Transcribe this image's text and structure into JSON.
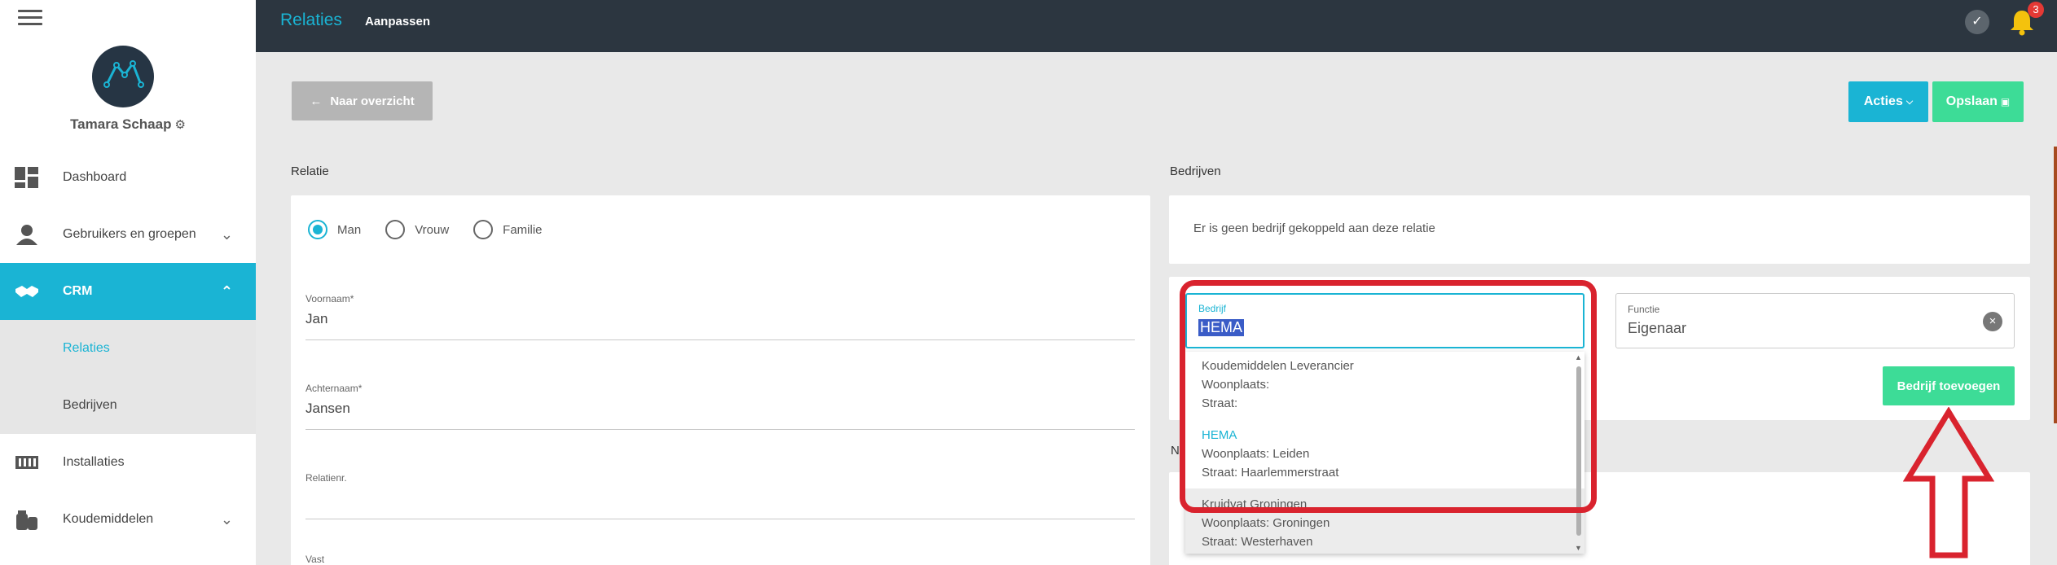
{
  "sidebar": {
    "user_name": "Tamara Schaap",
    "items": [
      {
        "label": "Dashboard"
      },
      {
        "label": "Gebruikers en groepen"
      },
      {
        "label": "CRM"
      },
      {
        "label": "Relaties"
      },
      {
        "label": "Bedrijven"
      },
      {
        "label": "Installaties"
      },
      {
        "label": "Koudemiddelen"
      }
    ]
  },
  "topbar": {
    "title": "Relaties",
    "subtitle": "Aanpassen",
    "notification_count": "3"
  },
  "toolbar": {
    "back_label": "Naar overzicht",
    "acties_label": "Acties",
    "opslaan_label": "Opslaan"
  },
  "relatie": {
    "section_title": "Relatie",
    "gender_options": [
      "Man",
      "Vrouw",
      "Familie"
    ],
    "selected_gender": "Man",
    "voornaam_label": "Voornaam*",
    "voornaam_value": "Jan",
    "achternaam_label": "Achternaam*",
    "achternaam_value": "Jansen",
    "relatienr_label": "Relatienr.",
    "relatienr_value": "",
    "vast_label": "Vast"
  },
  "bedrijven": {
    "section_title": "Bedrijven",
    "empty_message": "Er is geen bedrijf gekoppeld aan deze relatie",
    "bedrijf_label": "Bedrijf",
    "bedrijf_value": "HEMA",
    "functie_label": "Functie",
    "functie_value": "Eigenaar",
    "add_button_label": "Bedrijf toevoegen",
    "partial_heading": "N"
  },
  "dropdown": {
    "options": [
      {
        "name": "Koudemiddelen Leverancier",
        "woonplaats": "Woonplaats:",
        "straat": "Straat:"
      },
      {
        "name": "HEMA",
        "woonplaats": "Woonplaats: Leiden",
        "straat": "Straat: Haarlemmerstraat"
      },
      {
        "name": "Kruidvat Groningen",
        "woonplaats": "Woonplaats: Groningen",
        "straat": "Straat: Westerhaven"
      }
    ]
  },
  "colors": {
    "accent": "#1ab4d4",
    "success": "#3ddc97",
    "topbar": "#2c3640",
    "annotation_red": "#d9232e"
  }
}
